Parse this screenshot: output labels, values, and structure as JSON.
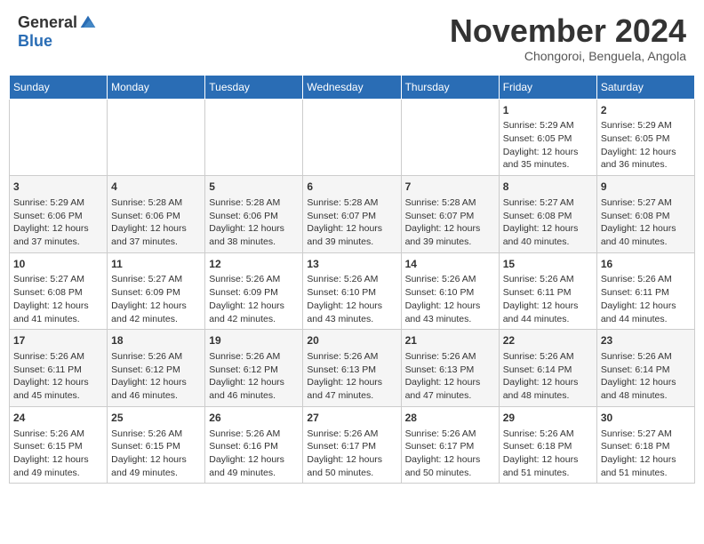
{
  "header": {
    "logo_general": "General",
    "logo_blue": "Blue",
    "month_title": "November 2024",
    "subtitle": "Chongoroi, Benguela, Angola"
  },
  "days_of_week": [
    "Sunday",
    "Monday",
    "Tuesday",
    "Wednesday",
    "Thursday",
    "Friday",
    "Saturday"
  ],
  "weeks": [
    {
      "cells": [
        {
          "day": "",
          "info": ""
        },
        {
          "day": "",
          "info": ""
        },
        {
          "day": "",
          "info": ""
        },
        {
          "day": "",
          "info": ""
        },
        {
          "day": "",
          "info": ""
        },
        {
          "day": "1",
          "info": "Sunrise: 5:29 AM\nSunset: 6:05 PM\nDaylight: 12 hours and 35 minutes."
        },
        {
          "day": "2",
          "info": "Sunrise: 5:29 AM\nSunset: 6:05 PM\nDaylight: 12 hours and 36 minutes."
        }
      ]
    },
    {
      "cells": [
        {
          "day": "3",
          "info": "Sunrise: 5:29 AM\nSunset: 6:06 PM\nDaylight: 12 hours and 37 minutes."
        },
        {
          "day": "4",
          "info": "Sunrise: 5:28 AM\nSunset: 6:06 PM\nDaylight: 12 hours and 37 minutes."
        },
        {
          "day": "5",
          "info": "Sunrise: 5:28 AM\nSunset: 6:06 PM\nDaylight: 12 hours and 38 minutes."
        },
        {
          "day": "6",
          "info": "Sunrise: 5:28 AM\nSunset: 6:07 PM\nDaylight: 12 hours and 39 minutes."
        },
        {
          "day": "7",
          "info": "Sunrise: 5:28 AM\nSunset: 6:07 PM\nDaylight: 12 hours and 39 minutes."
        },
        {
          "day": "8",
          "info": "Sunrise: 5:27 AM\nSunset: 6:08 PM\nDaylight: 12 hours and 40 minutes."
        },
        {
          "day": "9",
          "info": "Sunrise: 5:27 AM\nSunset: 6:08 PM\nDaylight: 12 hours and 40 minutes."
        }
      ]
    },
    {
      "cells": [
        {
          "day": "10",
          "info": "Sunrise: 5:27 AM\nSunset: 6:08 PM\nDaylight: 12 hours and 41 minutes."
        },
        {
          "day": "11",
          "info": "Sunrise: 5:27 AM\nSunset: 6:09 PM\nDaylight: 12 hours and 42 minutes."
        },
        {
          "day": "12",
          "info": "Sunrise: 5:26 AM\nSunset: 6:09 PM\nDaylight: 12 hours and 42 minutes."
        },
        {
          "day": "13",
          "info": "Sunrise: 5:26 AM\nSunset: 6:10 PM\nDaylight: 12 hours and 43 minutes."
        },
        {
          "day": "14",
          "info": "Sunrise: 5:26 AM\nSunset: 6:10 PM\nDaylight: 12 hours and 43 minutes."
        },
        {
          "day": "15",
          "info": "Sunrise: 5:26 AM\nSunset: 6:11 PM\nDaylight: 12 hours and 44 minutes."
        },
        {
          "day": "16",
          "info": "Sunrise: 5:26 AM\nSunset: 6:11 PM\nDaylight: 12 hours and 44 minutes."
        }
      ]
    },
    {
      "cells": [
        {
          "day": "17",
          "info": "Sunrise: 5:26 AM\nSunset: 6:11 PM\nDaylight: 12 hours and 45 minutes."
        },
        {
          "day": "18",
          "info": "Sunrise: 5:26 AM\nSunset: 6:12 PM\nDaylight: 12 hours and 46 minutes."
        },
        {
          "day": "19",
          "info": "Sunrise: 5:26 AM\nSunset: 6:12 PM\nDaylight: 12 hours and 46 minutes."
        },
        {
          "day": "20",
          "info": "Sunrise: 5:26 AM\nSunset: 6:13 PM\nDaylight: 12 hours and 47 minutes."
        },
        {
          "day": "21",
          "info": "Sunrise: 5:26 AM\nSunset: 6:13 PM\nDaylight: 12 hours and 47 minutes."
        },
        {
          "day": "22",
          "info": "Sunrise: 5:26 AM\nSunset: 6:14 PM\nDaylight: 12 hours and 48 minutes."
        },
        {
          "day": "23",
          "info": "Sunrise: 5:26 AM\nSunset: 6:14 PM\nDaylight: 12 hours and 48 minutes."
        }
      ]
    },
    {
      "cells": [
        {
          "day": "24",
          "info": "Sunrise: 5:26 AM\nSunset: 6:15 PM\nDaylight: 12 hours and 49 minutes."
        },
        {
          "day": "25",
          "info": "Sunrise: 5:26 AM\nSunset: 6:15 PM\nDaylight: 12 hours and 49 minutes."
        },
        {
          "day": "26",
          "info": "Sunrise: 5:26 AM\nSunset: 6:16 PM\nDaylight: 12 hours and 49 minutes."
        },
        {
          "day": "27",
          "info": "Sunrise: 5:26 AM\nSunset: 6:17 PM\nDaylight: 12 hours and 50 minutes."
        },
        {
          "day": "28",
          "info": "Sunrise: 5:26 AM\nSunset: 6:17 PM\nDaylight: 12 hours and 50 minutes."
        },
        {
          "day": "29",
          "info": "Sunrise: 5:26 AM\nSunset: 6:18 PM\nDaylight: 12 hours and 51 minutes."
        },
        {
          "day": "30",
          "info": "Sunrise: 5:27 AM\nSunset: 6:18 PM\nDaylight: 12 hours and 51 minutes."
        }
      ]
    }
  ]
}
